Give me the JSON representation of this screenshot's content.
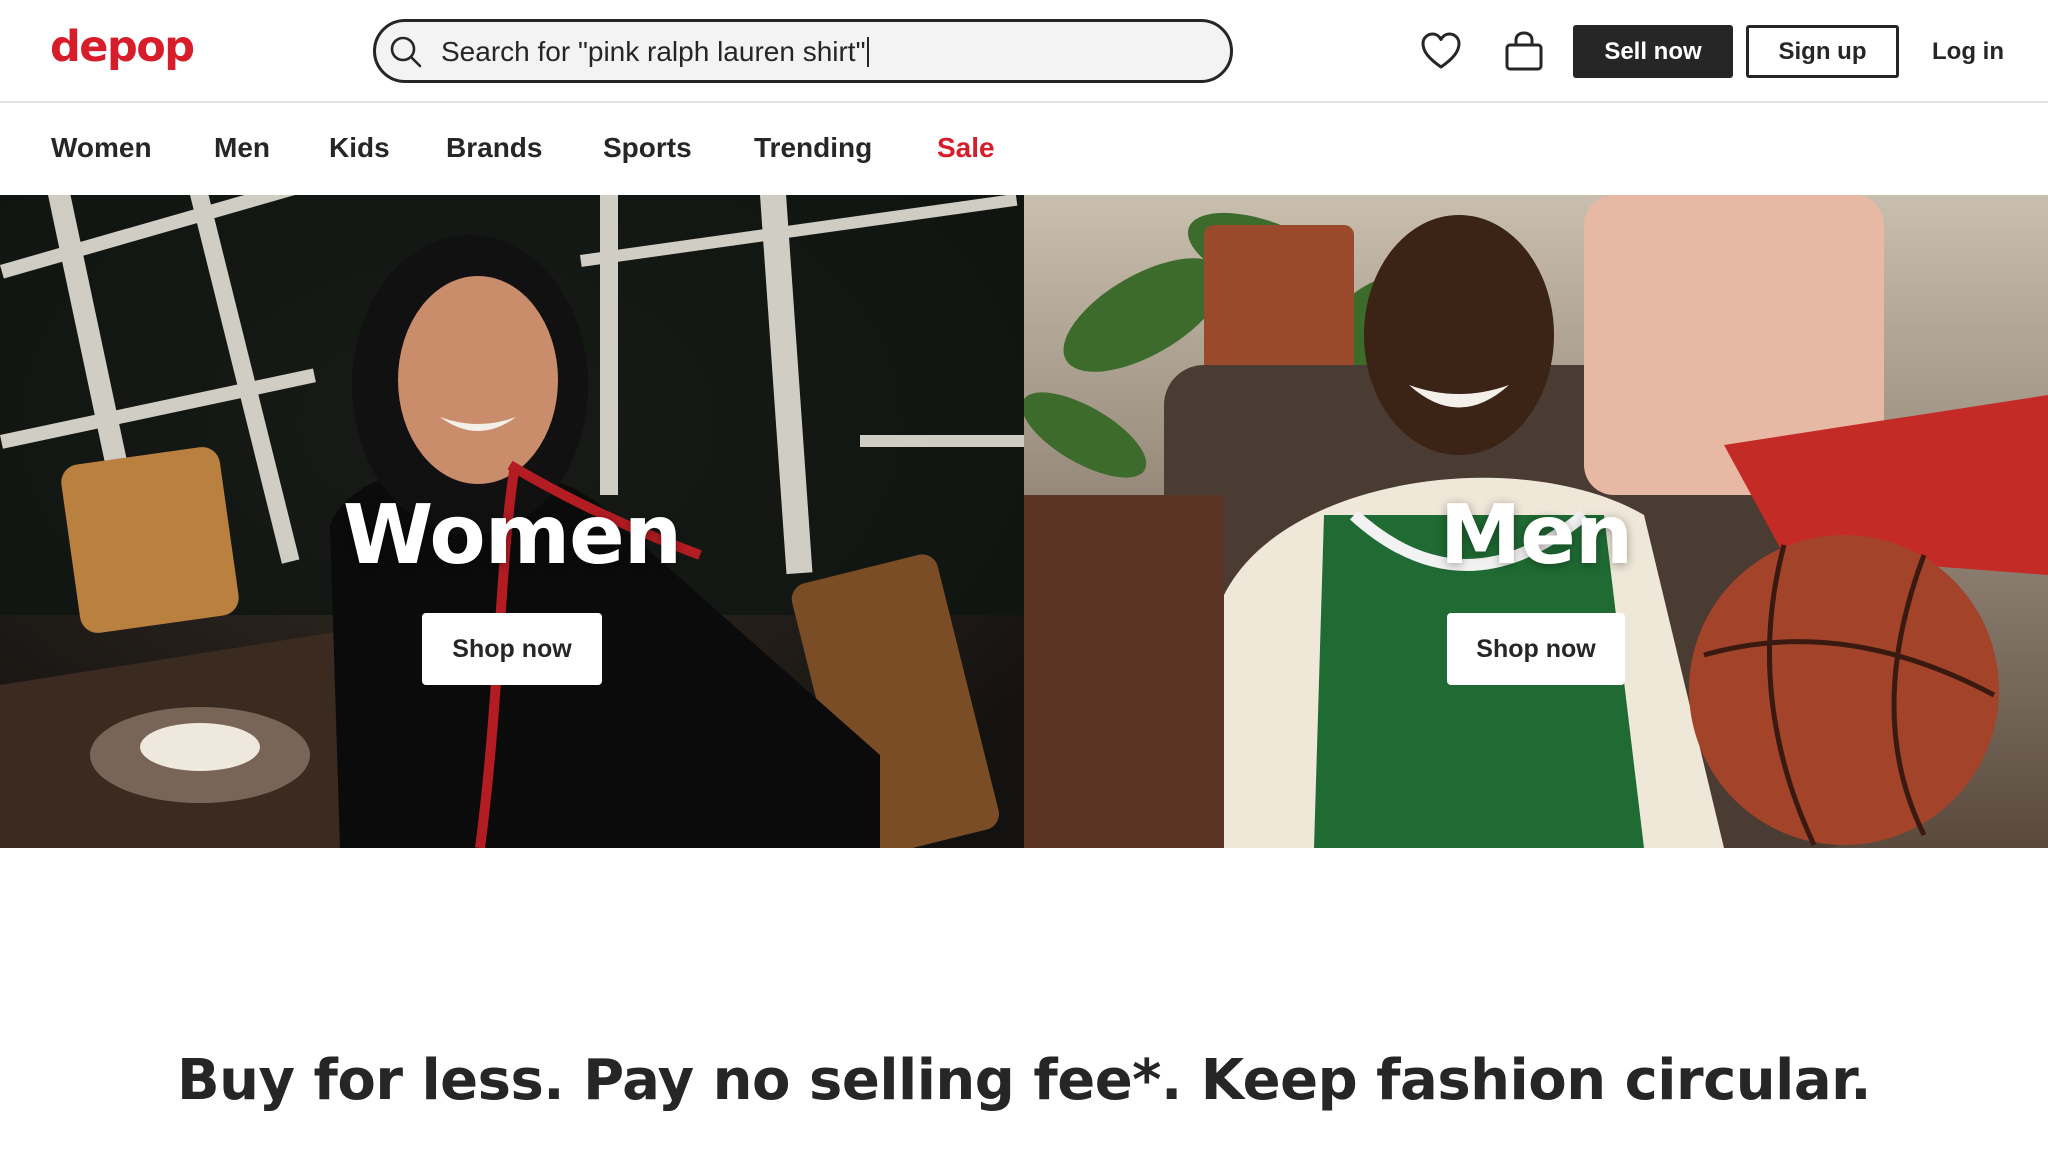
{
  "brand": {
    "logo_text": "depop",
    "accent_color": "#d71c2a"
  },
  "search": {
    "value": "Search for \"pink ralph lauren shirt\"",
    "icon": "search-icon"
  },
  "header_icons": {
    "favorites": "heart-icon",
    "bag": "shopping-bag-icon"
  },
  "header_actions": {
    "sell_label": "Sell now",
    "signup_label": "Sign up",
    "login_label": "Log in"
  },
  "nav": {
    "items": [
      {
        "label": "Women"
      },
      {
        "label": "Men"
      },
      {
        "label": "Kids"
      },
      {
        "label": "Brands"
      },
      {
        "label": "Sports"
      },
      {
        "label": "Trending"
      },
      {
        "label": "Sale",
        "color": "#d71c2a"
      }
    ]
  },
  "hero": {
    "women": {
      "title": "Women",
      "button": "Shop now"
    },
    "men": {
      "title": "Men",
      "button": "Shop now"
    }
  },
  "tagline": "Buy for less. Pay no selling fee*. Keep fashion circular."
}
